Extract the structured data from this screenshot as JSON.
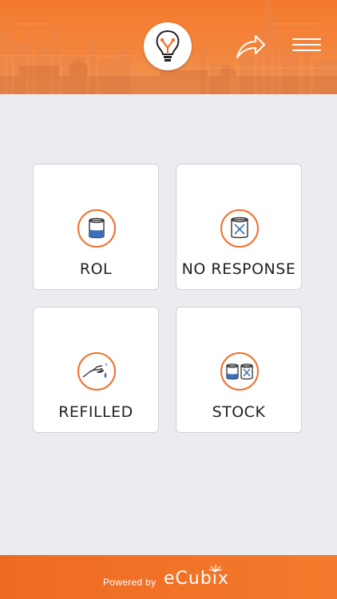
{
  "header": {
    "logo_icon": "lightbulb-icon",
    "share_icon": "share-arrow-icon",
    "menu_icon": "hamburger-menu-icon",
    "color": "#f47a2c"
  },
  "tiles": [
    {
      "label": "ROL",
      "icon": "beaker-level-icon"
    },
    {
      "label": "NO RESPONSE",
      "icon": "crossed-container-icon"
    },
    {
      "label": "REFILLED",
      "icon": "hand-pour-icon"
    },
    {
      "label": "STOCK",
      "icon": "stock-containers-icon"
    }
  ],
  "footer": {
    "powered_by": "Powered by",
    "brand": "eCubix"
  },
  "colors": {
    "accent": "#f0702a",
    "icon_blue": "#3c6fb6",
    "background": "#ebebf0"
  }
}
